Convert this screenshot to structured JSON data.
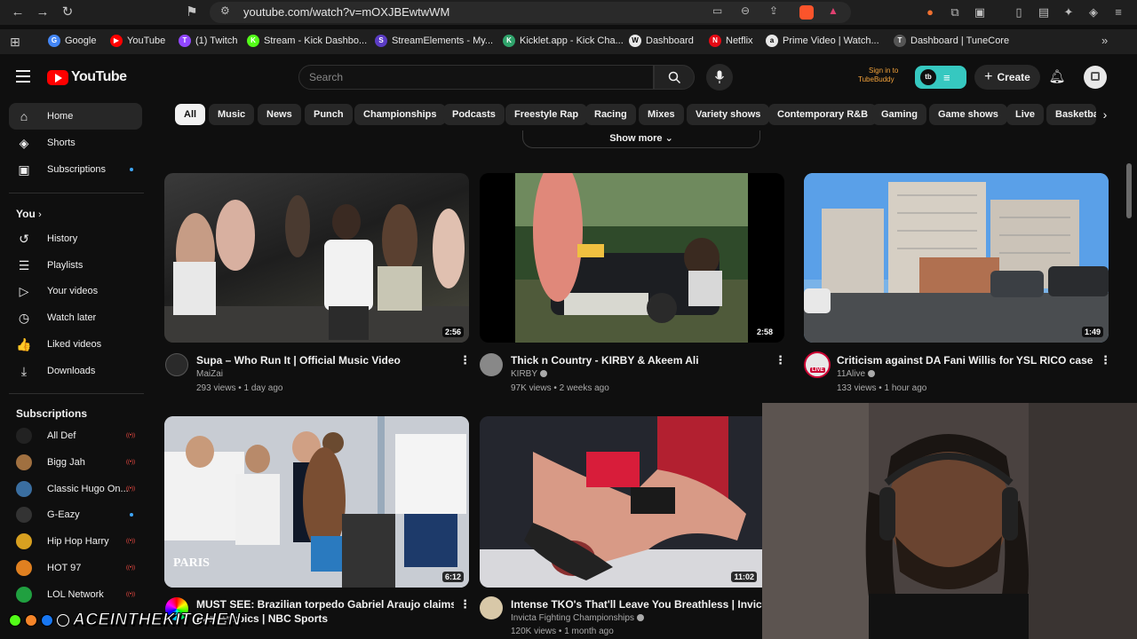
{
  "browser": {
    "url": "youtube.com/watch?v=mOXJBEwtwWM",
    "bookmarks": [
      {
        "label": "Google",
        "color": "#4285f4",
        "glyph": "G"
      },
      {
        "label": "YouTube",
        "color": "#ff0000",
        "glyph": "▶"
      },
      {
        "label": "(1) Twitch",
        "color": "#9146ff",
        "glyph": "T"
      },
      {
        "label": "Stream - Kick Dashbo...",
        "color": "#53fc18",
        "glyph": "K"
      },
      {
        "label": "StreamElements - My...",
        "color": "#5b3cc4",
        "glyph": "S"
      },
      {
        "label": "Kicklet.app - Kick Cha...",
        "color": "#2fa36b",
        "glyph": "K"
      },
      {
        "label": "Dashboard",
        "color": "#e8e8e8",
        "glyph": "W"
      },
      {
        "label": "Netflix",
        "color": "#e50914",
        "glyph": "N"
      },
      {
        "label": "Prime Video | Watch...",
        "color": "#e8e8e8",
        "glyph": "a"
      },
      {
        "label": "Dashboard | TuneCore",
        "color": "#555555",
        "glyph": "T"
      }
    ]
  },
  "header": {
    "logo_text": "YouTube",
    "search_placeholder": "Search",
    "tubebuddy_line1": "Sign in to",
    "tubebuddy_line2": "TubeBuddy",
    "create_label": "Create"
  },
  "sidebar": {
    "main": [
      {
        "label": "Home",
        "icon": "home-icon",
        "glyph": "⌂",
        "active": true
      },
      {
        "label": "Shorts",
        "icon": "shorts-icon",
        "glyph": "◈"
      },
      {
        "label": "Subscriptions",
        "icon": "subscriptions-icon",
        "glyph": "▣",
        "dot": true
      }
    ],
    "you_heading": "You",
    "you": [
      {
        "label": "History",
        "icon": "history-icon",
        "glyph": "↺"
      },
      {
        "label": "Playlists",
        "icon": "playlists-icon",
        "glyph": "☰"
      },
      {
        "label": "Your videos",
        "icon": "your-videos-icon",
        "glyph": "▷"
      },
      {
        "label": "Watch later",
        "icon": "watch-later-icon",
        "glyph": "◷"
      },
      {
        "label": "Liked videos",
        "icon": "liked-videos-icon",
        "glyph": "👍"
      },
      {
        "label": "Downloads",
        "icon": "downloads-icon",
        "glyph": "⤓"
      }
    ],
    "subs_heading": "Subscriptions",
    "subscriptions": [
      {
        "label": "All Def",
        "color": "#222222",
        "live": true
      },
      {
        "label": "Bigg Jah",
        "color": "#a07040",
        "live": true
      },
      {
        "label": "Classic Hugo On...",
        "color": "#3a6ea0",
        "live": true
      },
      {
        "label": "G-Eazy",
        "color": "#333333",
        "dot": true
      },
      {
        "label": "Hip Hop Harry",
        "color": "#d8a020",
        "live": true
      },
      {
        "label": "HOT 97",
        "color": "#e08020",
        "live": true
      },
      {
        "label": "LOL Network",
        "color": "#20a040",
        "live": true
      }
    ]
  },
  "chips": [
    "All",
    "Music",
    "News",
    "Punch",
    "Championships",
    "Podcasts",
    "Freestyle Rap",
    "Racing",
    "Mixes",
    "Variety shows",
    "Contemporary R&B",
    "Gaming",
    "Game shows",
    "Live",
    "Basketbal"
  ],
  "show_more": "Show more",
  "videos": [
    {
      "title": "Supa – Who Run It | Official Music Video",
      "channel": "MaiZai",
      "meta": "293 views • 1 day ago",
      "duration": "2:56",
      "verified": false
    },
    {
      "title": "Thick n Country - KIRBY & Akeem Ali",
      "channel": "KIRBY",
      "meta": "97K views • 2 weeks ago",
      "duration": "2:58",
      "verified": true
    },
    {
      "title": "Criticism against DA Fani Willis for YSL RICO case",
      "channel": "11Alive",
      "meta": "133 views • 1 hour ago",
      "duration": "1:49",
      "verified": true
    },
    {
      "title": "MUST SEE: Brazilian torpedo Gabriel Araujo claims",
      "title2": "Paralympics | NBC Sports",
      "channel": "",
      "meta": "",
      "duration": "6:12",
      "overlay": "PARIS"
    },
    {
      "title": "Intense TKO's That'll Leave You Breathless | Invicta FC",
      "channel": "Invicta Fighting Championships",
      "meta": "120K views • 1 month ago",
      "duration": "11:02",
      "verified": true
    }
  ],
  "watermark": "ACEINTHEKITCHEN",
  "colors": {
    "accent_red": "#ff0000",
    "chip_active": "#f1f1f1",
    "tubebuddy": "#36c8c0",
    "bg": "#0f0f0f"
  }
}
